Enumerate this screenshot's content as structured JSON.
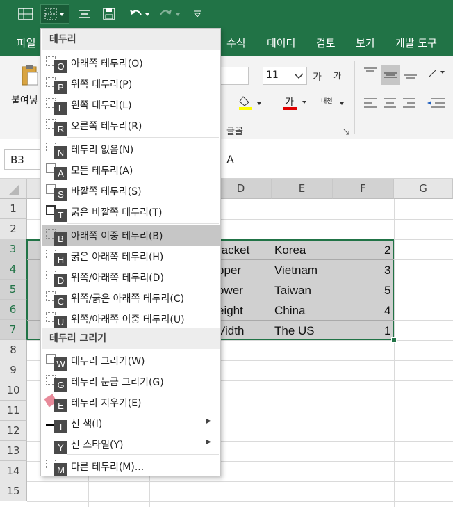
{
  "colors": {
    "accent": "#217346",
    "selection_fill": "#d0d0d0",
    "menu_highlight": "#c6c6c6"
  },
  "qat": {
    "icons": [
      "table-view-icon",
      "border-icon",
      "align-icon",
      "save-icon",
      "undo-icon",
      "redo-icon",
      "customize-icon"
    ]
  },
  "tabs": [
    "파일",
    "수식",
    "데이터",
    "검토",
    "보기",
    "개발 도구"
  ],
  "ribbon": {
    "paste_label": "붙여넣",
    "font_size": "11",
    "grow_font": "가",
    "shrink_font": "가",
    "font_color_label": "가",
    "phonetic_label": "내천",
    "group_font": "글꼴"
  },
  "formula_bar": {
    "name_box": "B3",
    "formula": "A"
  },
  "columns": [
    "D",
    "E",
    "F",
    "G"
  ],
  "rows": [
    "1",
    "2",
    "3",
    "4",
    "5",
    "6",
    "7",
    "8",
    "9",
    "10",
    "11",
    "12",
    "13",
    "14",
    "15"
  ],
  "cells": [
    {
      "d": "racket",
      "e": "Korea",
      "f": "2"
    },
    {
      "d": "pper",
      "e": "Vietnam",
      "f": "3"
    },
    {
      "d": "ower",
      "e": "Taiwan",
      "f": "5"
    },
    {
      "d": "eight",
      "e": "China",
      "f": "4"
    },
    {
      "d": "Vidth",
      "e": "The US",
      "f": "1"
    }
  ],
  "menu": {
    "header_borders": "테두리",
    "header_draw": "테두리 그리기",
    "items": [
      {
        "label": "아래쪽 테두리(O)",
        "key": "O"
      },
      {
        "label": "위쪽 테두리(P)",
        "key": "P"
      },
      {
        "label": "왼쪽 테두리(L)",
        "key": "L"
      },
      {
        "label": "오른쪽 테두리(R)",
        "key": "R"
      },
      {
        "label": "테두리 없음(N)",
        "key": "N"
      },
      {
        "label": "모든 테두리(A)",
        "key": "A"
      },
      {
        "label": "바깥쪽 테두리(S)",
        "key": "S"
      },
      {
        "label": "굵은 바깥쪽 테두리(T)",
        "key": "T"
      },
      {
        "label": "아래쪽 이중 테두리(B)",
        "key": "B"
      },
      {
        "label": "굵은 아래쪽 테두리(H)",
        "key": "H"
      },
      {
        "label": "위쪽/아래쪽 테두리(D)",
        "key": "D"
      },
      {
        "label": "위쪽/굵은 아래쪽 테두리(C)",
        "key": "C"
      },
      {
        "label": "위쪽/아래쪽 이중 테두리(U)",
        "key": "U"
      }
    ],
    "draw_items": [
      {
        "label": "테두리 그리기(W)",
        "key": "W"
      },
      {
        "label": "테두리 눈금 그리기(G)",
        "key": "G"
      },
      {
        "label": "테두리 지우기(E)",
        "key": "E"
      },
      {
        "label": "선 색(I)",
        "key": "I"
      },
      {
        "label": "선 스타일(Y)",
        "key": "Y"
      },
      {
        "label": "다른 테두리(M)...",
        "key": "M"
      }
    ]
  }
}
